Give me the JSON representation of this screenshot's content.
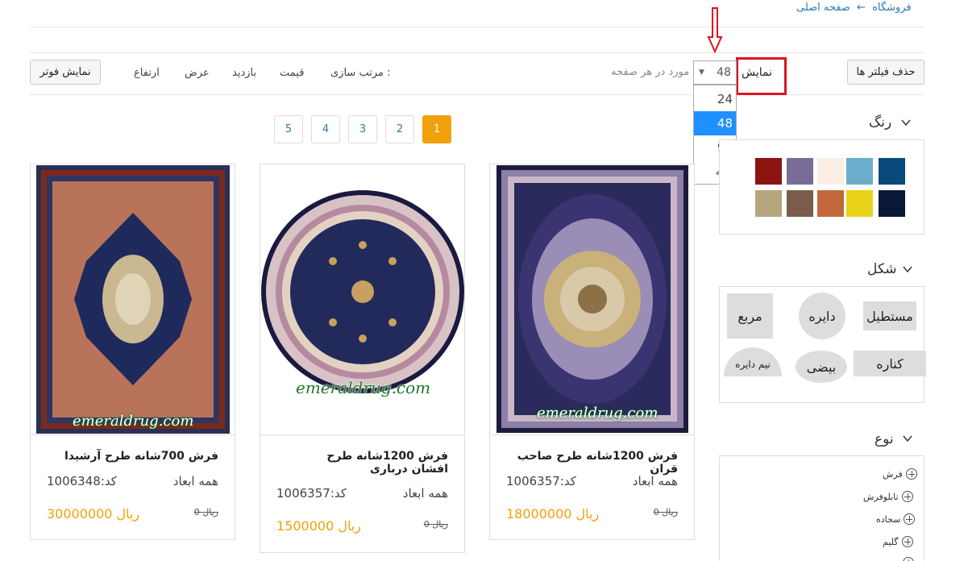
{
  "breadcrumb": {
    "home": "صفحه اصلی",
    "arrow": "←",
    "current": "فروشگاه"
  },
  "toolbar": {
    "clear_filters": "حذف فیلتر ها",
    "show_label": "نمایش",
    "per_page_suffix": "مورد در هر صفحه",
    "per_page_value": "48",
    "per_page_options": [
      "24",
      "48",
      "96",
      "همه"
    ],
    "sort_label": "مرتب سازی :",
    "sort_options": [
      "قیمت",
      "بازدید",
      "عرض",
      "ارتفاع"
    ],
    "show_footer": "نمایش فوتر"
  },
  "pagination": {
    "pages": [
      "1",
      "2",
      "3",
      "4",
      "5"
    ],
    "active": "1"
  },
  "sidebar": {
    "color": {
      "title": "رنگ",
      "swatches": [
        "#0a4a7a",
        "#6aaecb",
        "#fbeee4",
        "#7a6c99",
        "#8b1411",
        "#0a1838",
        "#e8d21a",
        "#c2683c",
        "#7c5c4c",
        "#b5a67d"
      ]
    },
    "shape": {
      "title": "شکل",
      "items": [
        "مستطیل",
        "دایره",
        "مربع",
        "کناره",
        "بیضی",
        "نیم دایره"
      ]
    },
    "type": {
      "title": "نوع",
      "items": [
        "فرش",
        "تابلوفرش",
        "سجاده",
        "گلیم"
      ]
    }
  },
  "products": [
    {
      "title": "فرش 1200شانه طرح صاحب قران",
      "dims": "همه ابعاد",
      "code": "کد:1006357",
      "old_price": "0 ریال",
      "price": "18000000 ریال",
      "watermark": "emeraldrug.com"
    },
    {
      "title": "فرش 1200شانه طرح افشان درباری",
      "dims": "همه ابعاد",
      "code": "کد:1006357",
      "old_price": "0 ریال",
      "price": "1500000 ریال",
      "watermark": "emeraldrug.com"
    },
    {
      "title": "فرش 700شانه طرح آرشیدا",
      "dims": "همه ابعاد",
      "code": "کد:1006348",
      "old_price": "0 ریال",
      "price": "30000000 ریال",
      "watermark": "emeraldrug.com"
    }
  ]
}
